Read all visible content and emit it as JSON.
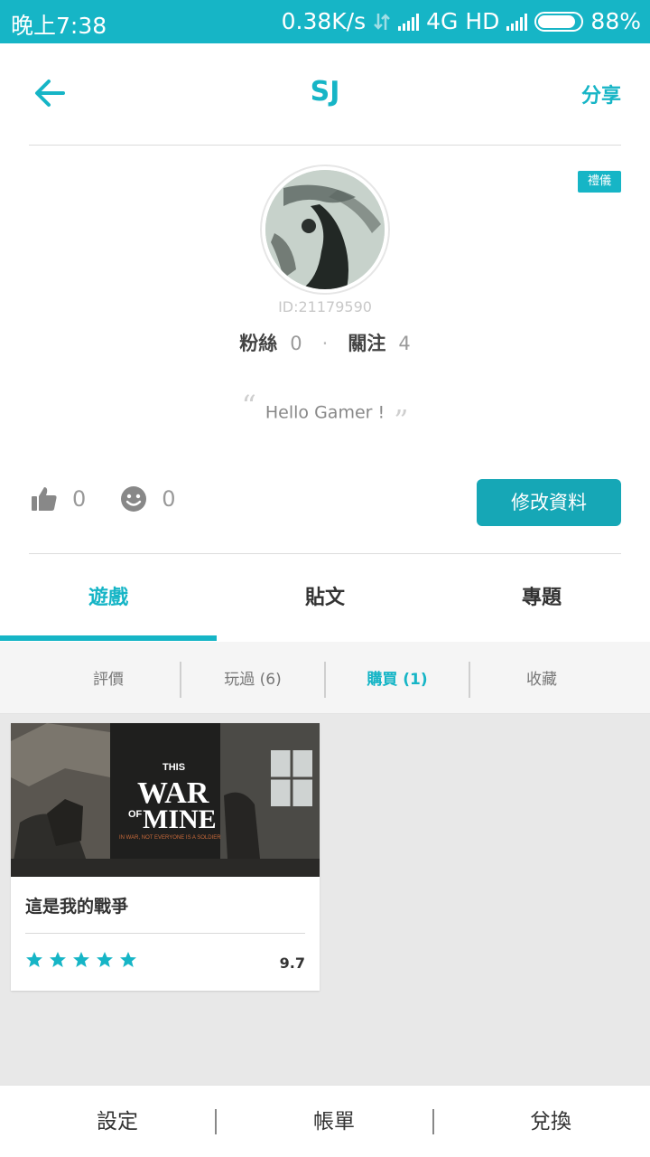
{
  "status_bar": {
    "time": "晚上7:38",
    "net_speed": "0.38K/s",
    "network": "4G HD",
    "battery": "88%",
    "battery_level": 0.88
  },
  "header": {
    "title": "SJ",
    "share": "分享",
    "back_icon": "arrow-left-icon"
  },
  "profile": {
    "badge": "禮儀",
    "id": "ID:21179590",
    "fans_label": "粉絲",
    "fans_count": "0",
    "follow_label": "關注",
    "follow_count": "4",
    "separator": "·",
    "quote": "Hello Gamer !",
    "likes": "0",
    "smiles": "0",
    "edit_button": "修改資料"
  },
  "tabs": [
    {
      "label": "遊戲",
      "active": true
    },
    {
      "label": "貼文",
      "active": false
    },
    {
      "label": "專題",
      "active": false
    }
  ],
  "subtabs": [
    {
      "label": "評價",
      "active": false
    },
    {
      "label": "玩過 (6)",
      "active": false
    },
    {
      "label": "購買 (1)",
      "active": true
    },
    {
      "label": "收藏",
      "active": false
    }
  ],
  "games": [
    {
      "name": "這是我的戰爭",
      "score": "9.7",
      "rating": 5,
      "art_title_top": "THIS",
      "art_title_mid": "WAR",
      "art_title_of": "OF",
      "art_title_bottom": "MINE",
      "art_tagline": "IN WAR, NOT EVERYONE IS A SOLDIER"
    }
  ],
  "bottom_bar": [
    "設定",
    "帳單",
    "兌換"
  ],
  "colors": {
    "accent": "#16b5c6",
    "button": "#16a7b6",
    "content_bg": "#e8e8e8"
  }
}
